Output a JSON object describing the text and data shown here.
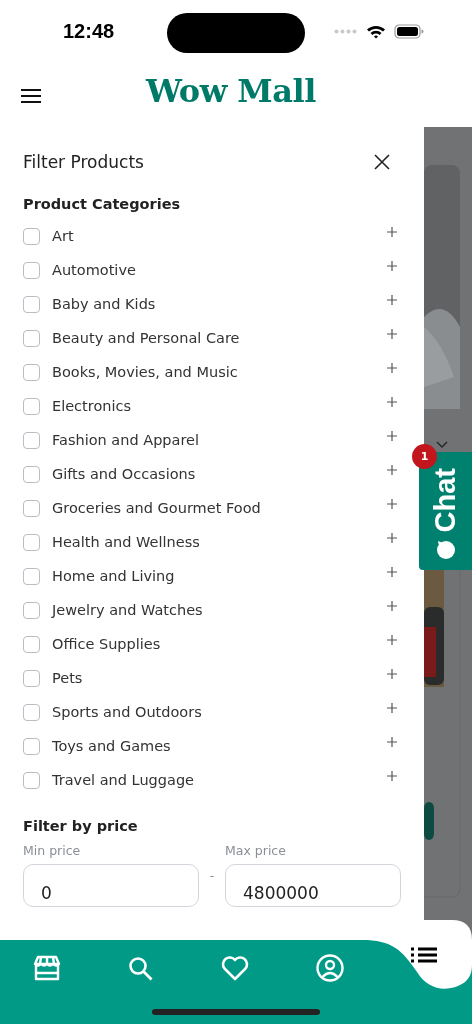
{
  "status_bar": {
    "time": "12:48"
  },
  "header": {
    "logo": "Wow Mall"
  },
  "drawer": {
    "title": "Filter Products",
    "categories_heading": "Product Categories",
    "categories": [
      {
        "label": "Art",
        "checked": false
      },
      {
        "label": "Automotive",
        "checked": false
      },
      {
        "label": "Baby and Kids",
        "checked": false
      },
      {
        "label": "Beauty and Personal Care",
        "checked": false
      },
      {
        "label": "Books, Movies, and Music",
        "checked": false
      },
      {
        "label": "Electronics",
        "checked": false
      },
      {
        "label": "Fashion and Apparel",
        "checked": false
      },
      {
        "label": "Gifts and Occasions",
        "checked": false
      },
      {
        "label": "Groceries and Gourmet Food",
        "checked": false
      },
      {
        "label": "Health and Wellness",
        "checked": false
      },
      {
        "label": "Home and Living",
        "checked": false
      },
      {
        "label": "Jewelry and Watches",
        "checked": false
      },
      {
        "label": "Office Supplies",
        "checked": false
      },
      {
        "label": "Pets",
        "checked": false
      },
      {
        "label": "Sports and Outdoors",
        "checked": false
      },
      {
        "label": "Toys and Games",
        "checked": false
      },
      {
        "label": "Travel and Luggage",
        "checked": false
      }
    ],
    "price": {
      "heading": "Filter by price",
      "min": {
        "label": "Min price",
        "value": "0"
      },
      "separator": "-",
      "max": {
        "label": "Max price",
        "value": "4800000"
      }
    }
  },
  "chat": {
    "label": "Chat",
    "badge": "1"
  },
  "bottom_nav": {
    "items": [
      {
        "kind": "store",
        "selected": false
      },
      {
        "kind": "search",
        "selected": false
      },
      {
        "kind": "heart",
        "selected": false
      },
      {
        "kind": "profile",
        "selected": false
      },
      {
        "kind": "list",
        "selected": true
      }
    ]
  }
}
